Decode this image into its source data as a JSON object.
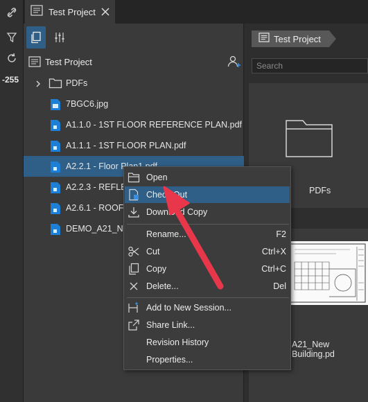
{
  "rail": {
    "counter": "-255",
    "icons": [
      "link-off-icon",
      "filter-icon",
      "refresh-icon"
    ]
  },
  "tab": {
    "label": "Test Project"
  },
  "panel": {
    "project_title": "Test Project",
    "items": [
      {
        "label": "PDFs",
        "type": "folder"
      },
      {
        "label": "7BGC6.jpg",
        "type": "image"
      },
      {
        "label": "A1.1.0 - 1ST FLOOR REFERENCE PLAN.pdf",
        "type": "pdf"
      },
      {
        "label": "A1.1.1 - 1ST FLOOR PLAN.pdf",
        "type": "pdf"
      },
      {
        "label": "A2.2.1 - Floor Plan1.pdf",
        "type": "pdf"
      },
      {
        "label": "A2.2.3 - REFLEC",
        "type": "pdf"
      },
      {
        "label": "A2.6.1 - ROOF F",
        "type": "pdf"
      },
      {
        "label": "DEMO_A21_New",
        "type": "pdf"
      }
    ]
  },
  "content": {
    "breadcrumb": "Test Project",
    "search_placeholder": "Search",
    "cards": [
      {
        "label": "PDFs"
      },
      {
        "label": "A21_New Building.pd"
      }
    ]
  },
  "context_menu": {
    "items": [
      {
        "label": "Open",
        "shortcut": ""
      },
      {
        "label": "Check Out",
        "shortcut": ""
      },
      {
        "label": "Download Copy",
        "shortcut": ""
      },
      {
        "label": "Rename...",
        "shortcut": "F2"
      },
      {
        "label": "Cut",
        "shortcut": "Ctrl+X"
      },
      {
        "label": "Copy",
        "shortcut": "Ctrl+C"
      },
      {
        "label": "Delete...",
        "shortcut": "Del"
      },
      {
        "label": "Add to New Session...",
        "shortcut": ""
      },
      {
        "label": "Share Link...",
        "shortcut": ""
      },
      {
        "label": "Revision History",
        "shortcut": ""
      },
      {
        "label": "Properties...",
        "shortcut": ""
      }
    ]
  },
  "colors": {
    "accent": "#2f5f86",
    "arrow": "#e8374a",
    "panel": "#3a3a3a"
  }
}
